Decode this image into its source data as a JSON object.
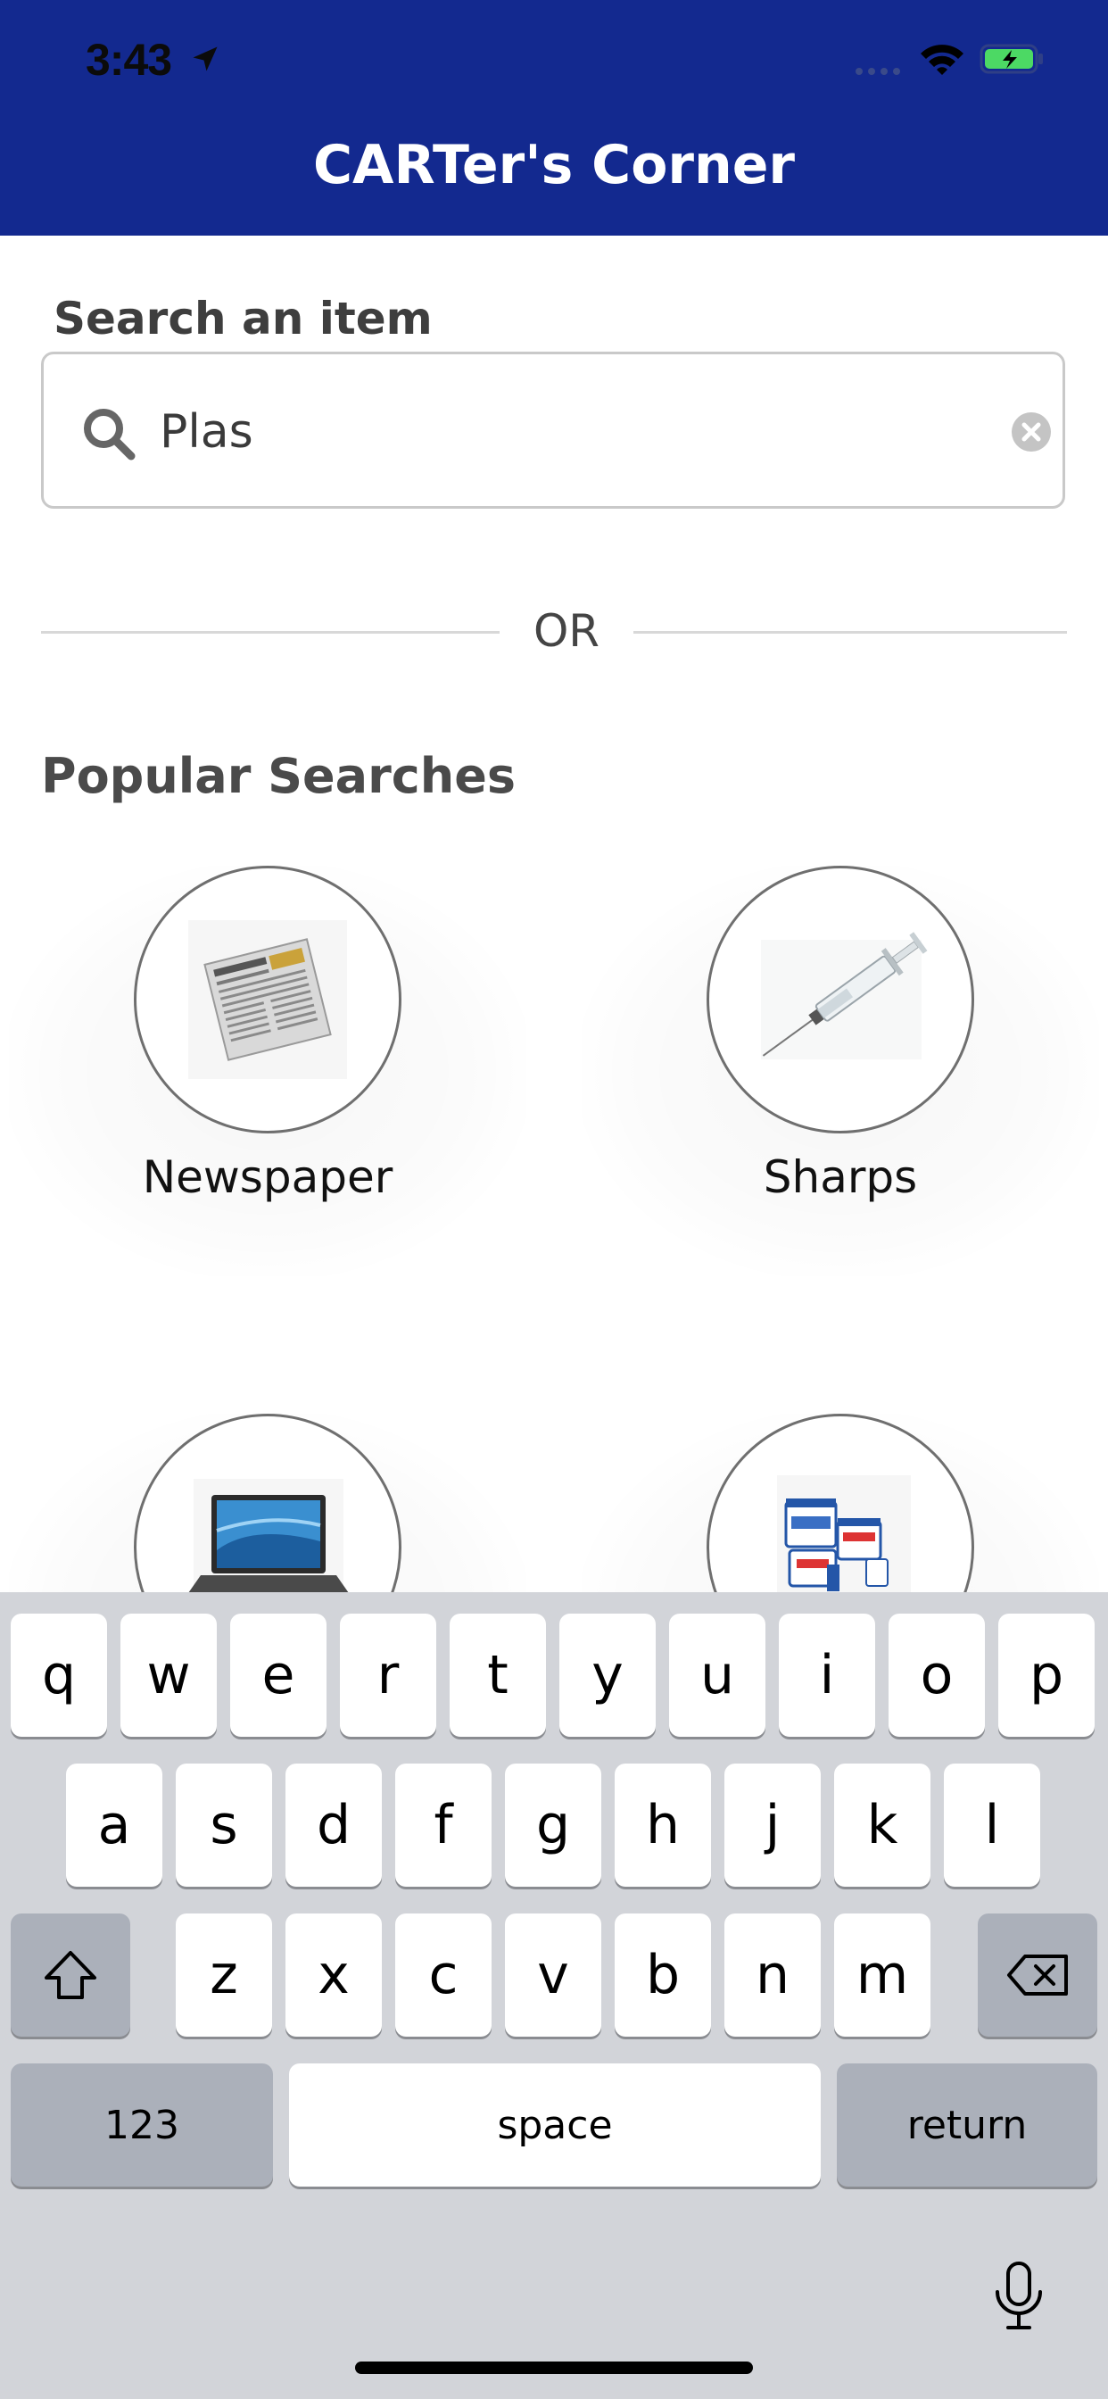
{
  "status_bar": {
    "time": "3:43"
  },
  "header": {
    "title": "CARTer's Corner",
    "background_color": "#13298f"
  },
  "search": {
    "label": "Search an item",
    "value": "Plas"
  },
  "divider": {
    "text": "OR"
  },
  "popular": {
    "title": "Popular Searches",
    "items": [
      {
        "label": "Newspaper",
        "icon": "newspaper-image"
      },
      {
        "label": "Sharps",
        "icon": "syringe-image"
      },
      {
        "label": "",
        "icon": "laptop-image"
      },
      {
        "label": "",
        "icon": "chemical-buckets-image"
      }
    ]
  },
  "keyboard": {
    "row1": [
      "q",
      "w",
      "e",
      "r",
      "t",
      "y",
      "u",
      "i",
      "o",
      "p"
    ],
    "row2": [
      "a",
      "s",
      "d",
      "f",
      "g",
      "h",
      "j",
      "k",
      "l"
    ],
    "row3": [
      "z",
      "x",
      "c",
      "v",
      "b",
      "n",
      "m"
    ],
    "numbers_label": "123",
    "space_label": "space",
    "return_label": "return"
  }
}
